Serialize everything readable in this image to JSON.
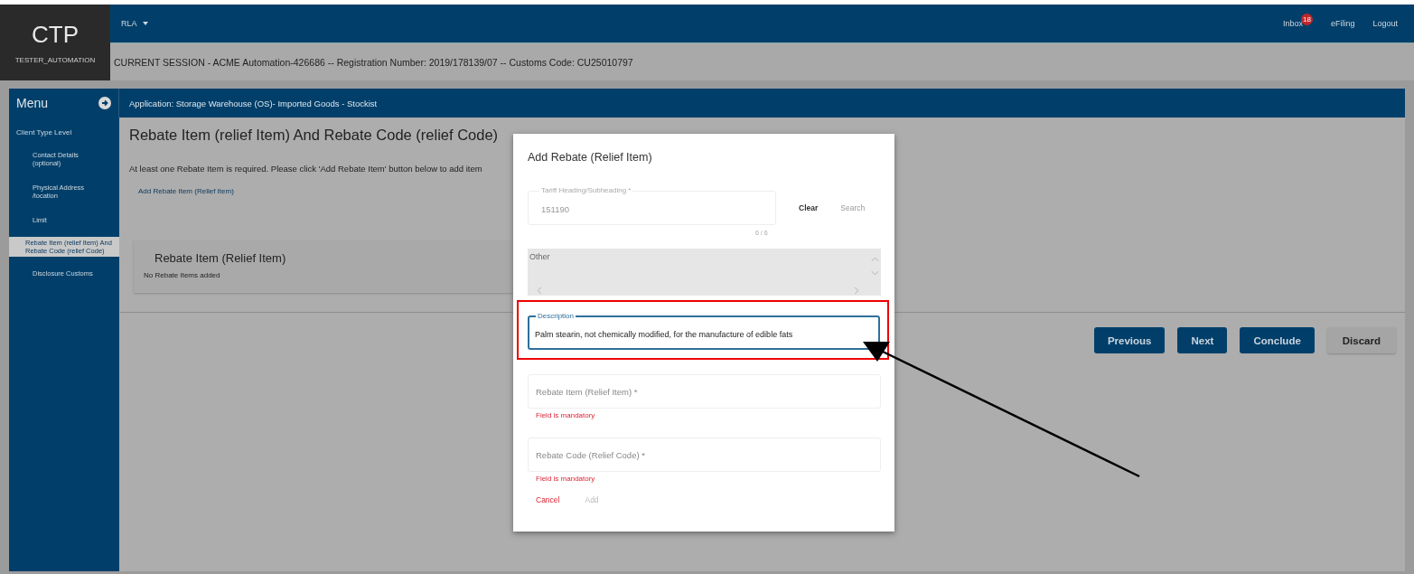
{
  "header": {
    "logo": "CTP",
    "user": "TESTER_AUTOMATION",
    "menu": "RLA",
    "links": [
      {
        "label": "Inbox",
        "badge": "18"
      },
      {
        "label": "eFiling"
      },
      {
        "label": "Logout"
      }
    ],
    "session": "CURRENT SESSION - ACME Automation-426686 -- Registration Number: 2019/178139/07 -- Customs Code: CU25010797"
  },
  "sidebar": {
    "title": "Menu",
    "items": [
      {
        "label": "Client Type Level",
        "kind": "heading",
        "selected": false
      },
      {
        "label": "Contact Details (optional)",
        "kind": "step",
        "selected": false
      },
      {
        "label": "Physical Address /location",
        "kind": "step",
        "selected": false
      },
      {
        "label": "Limit",
        "kind": "step",
        "selected": false
      },
      {
        "label": "Rebate Item (relief Item) And Rebate Code (relief Code)",
        "kind": "step",
        "selected": true
      },
      {
        "label": "Disclosure Customs",
        "kind": "step",
        "selected": false
      }
    ]
  },
  "application": "Application: Storage Warehouse (OS)- Imported Goods - Stockist",
  "page": {
    "title": "Rebate Item (relief Item) And Rebate Code (relief Code)",
    "message": "At least one Rebate Item is required. Please click 'Add Rebate Item' button below to add item",
    "add_link": "Add Rebate Item (Relief Item)",
    "card": {
      "title": "Rebate Item (Relief Item)",
      "empty": "No Rebate Items added"
    },
    "buttons": [
      {
        "label": "Previous",
        "kind": "primary"
      },
      {
        "label": "Next",
        "kind": "primary"
      },
      {
        "label": "Conclude",
        "kind": "primary"
      },
      {
        "label": "Discard",
        "kind": "secondary"
      }
    ]
  },
  "dialog": {
    "title": "Add Rebate (Relief Item)",
    "tariff": {
      "label": "Tariff Heading/Subheading *",
      "value": "151190",
      "counter": "6 / 6"
    },
    "actions": [
      {
        "label": "Clear",
        "disabled": false
      },
      {
        "label": "Search",
        "disabled": true
      }
    ],
    "result": "Other",
    "description": {
      "label": "Description",
      "value": "Palm stearin, not chemically modified, for the manufacture of edible fats",
      "highlighted": true
    },
    "fields": [
      {
        "placeholder": "Rebate Item (Relief Item) *",
        "error": "Field is mandatory"
      },
      {
        "placeholder": "Rebate Code (Relief Code) *",
        "error": "Field is mandatory"
      }
    ],
    "buttons": [
      {
        "label": "Cancel",
        "disabled": false
      },
      {
        "label": "Add",
        "disabled": true
      }
    ]
  }
}
